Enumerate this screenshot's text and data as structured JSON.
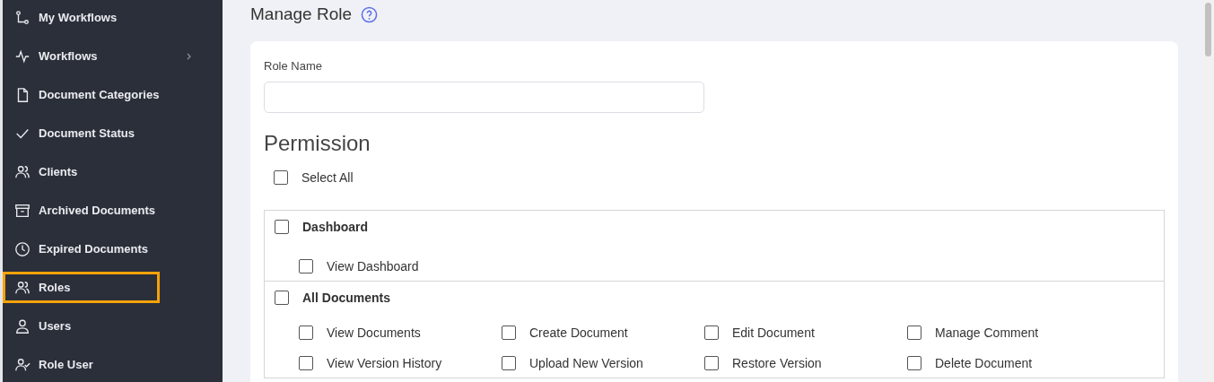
{
  "sidebar": {
    "items": [
      {
        "label": "My Workflows",
        "selected": false,
        "has_submenu": false
      },
      {
        "label": "Workflows",
        "selected": false,
        "has_submenu": true
      },
      {
        "label": "Document Categories",
        "selected": false,
        "has_submenu": false
      },
      {
        "label": "Document Status",
        "selected": false,
        "has_submenu": false
      },
      {
        "label": "Clients",
        "selected": false,
        "has_submenu": false
      },
      {
        "label": "Archived Documents",
        "selected": false,
        "has_submenu": false
      },
      {
        "label": "Expired Documents",
        "selected": false,
        "has_submenu": false
      },
      {
        "label": "Roles",
        "selected": true,
        "has_submenu": false
      },
      {
        "label": "Users",
        "selected": false,
        "has_submenu": false
      },
      {
        "label": "Role User",
        "selected": false,
        "has_submenu": false
      }
    ]
  },
  "page": {
    "title": "Manage Role"
  },
  "form": {
    "role_name": {
      "label": "Role Name"
    },
    "permission_heading": "Permission",
    "select_all": {
      "label": "Select All",
      "checked": false
    },
    "groups": [
      {
        "name": "Dashboard",
        "checked": false,
        "permissions": [
          {
            "label": "View Dashboard",
            "checked": false
          }
        ]
      },
      {
        "name": "All Documents",
        "checked": false,
        "permissions": [
          {
            "label": "View Documents",
            "checked": false
          },
          {
            "label": "Create Document",
            "checked": false
          },
          {
            "label": "Edit Document",
            "checked": false
          },
          {
            "label": "Manage Comment",
            "checked": false
          },
          {
            "label": "View Version History",
            "checked": false
          },
          {
            "label": "Upload New Version",
            "checked": false
          },
          {
            "label": "Restore Version",
            "checked": false
          },
          {
            "label": "Delete Document",
            "checked": false
          }
        ]
      }
    ]
  }
}
